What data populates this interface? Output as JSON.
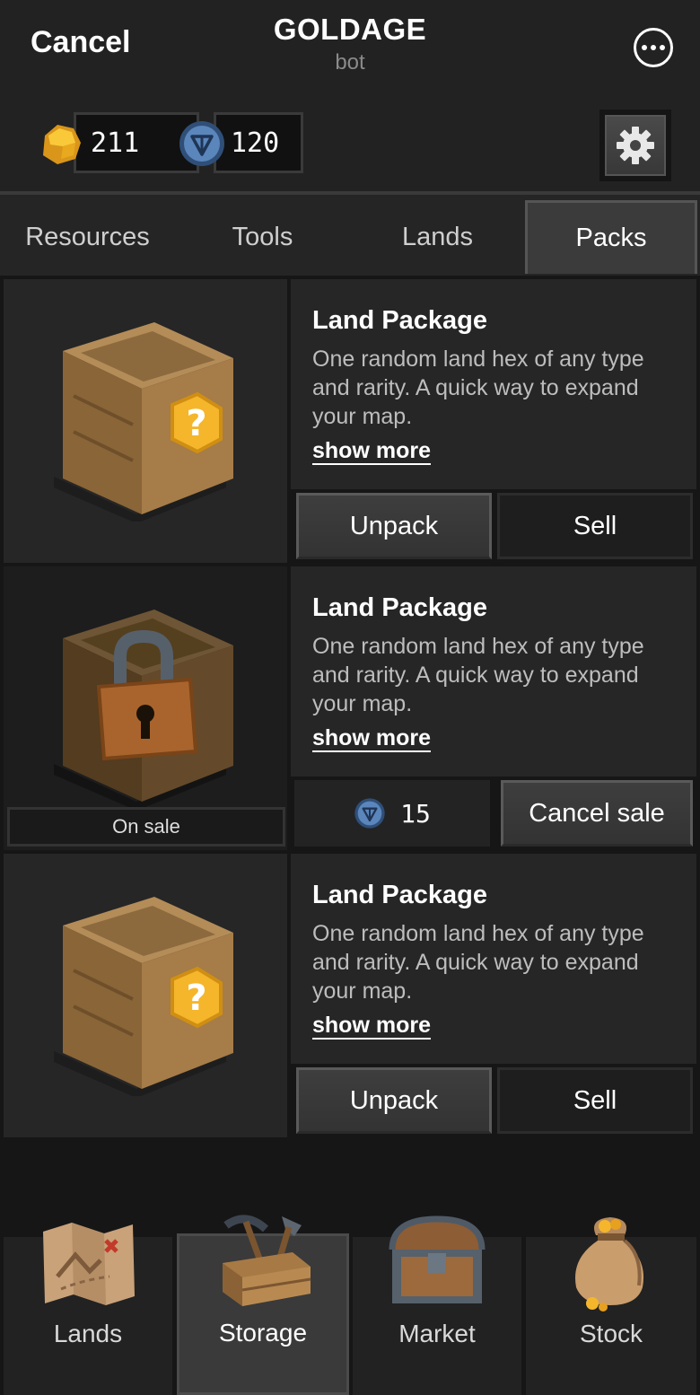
{
  "header": {
    "cancel_label": "Cancel",
    "title": "GOLDAGE",
    "subtitle": "bot",
    "more_icon": "more-dots-icon"
  },
  "currencies": [
    {
      "icon": "gold-nugget-icon",
      "value": "211",
      "color": "#f2b62a"
    },
    {
      "icon": "ton-coin-icon",
      "value": "120",
      "color": "#4a6fa0"
    }
  ],
  "settings_icon": "gear-icon",
  "tabs": [
    {
      "label": "Resources",
      "active": false
    },
    {
      "label": "Tools",
      "active": false
    },
    {
      "label": "Lands",
      "active": false
    },
    {
      "label": "Packs",
      "active": true
    }
  ],
  "packs": [
    {
      "title": "Land Package",
      "description": "One random land hex of any type and rarity. A quick way to expand your map.",
      "show_more": "show more",
      "image": "crate-question-icon",
      "state": "owned",
      "primary_label": "Unpack",
      "secondary_label": "Sell"
    },
    {
      "title": "Land Package",
      "description": "One random land hex of any type and rarity. A quick way to expand your map.",
      "show_more": "show more",
      "image": "crate-locked-icon",
      "state": "on_sale",
      "sale_label": "On sale",
      "price": "15",
      "price_icon": "ton-coin-icon",
      "secondary_label": "Cancel sale"
    },
    {
      "title": "Land Package",
      "description": "One random land hex of any type and rarity. A quick way to expand your map.",
      "show_more": "show more",
      "image": "crate-question-icon",
      "state": "owned",
      "primary_label": "Unpack",
      "secondary_label": "Sell"
    }
  ],
  "bottom_nav": [
    {
      "label": "Lands",
      "icon": "treasure-map-icon",
      "active": false
    },
    {
      "label": "Storage",
      "icon": "toolbox-icon",
      "active": true
    },
    {
      "label": "Market",
      "icon": "chest-icon",
      "active": false
    },
    {
      "label": "Stock",
      "icon": "gold-sack-icon",
      "active": false
    }
  ],
  "colors": {
    "background": "#161616",
    "panel": "#262626",
    "gold": "#f2b62a",
    "crate": "#9a7446"
  }
}
